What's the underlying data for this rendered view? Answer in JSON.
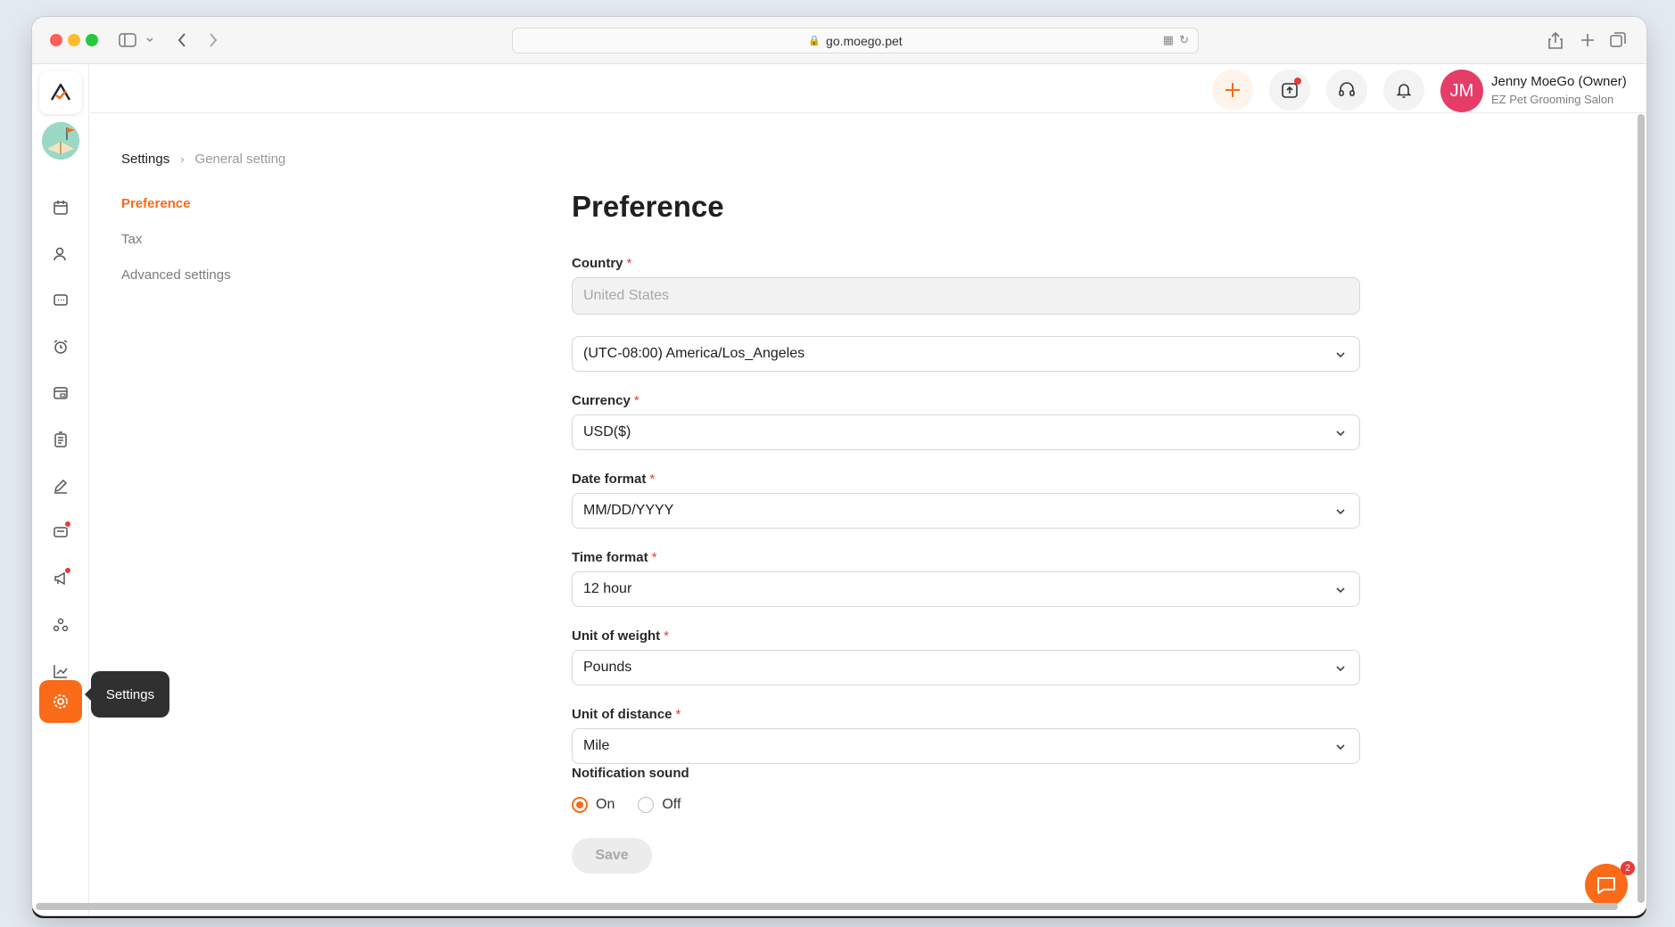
{
  "browser": {
    "url": "go.moego.pet"
  },
  "topbar": {
    "user_initials": "JM",
    "user_name": "Jenny MoeGo (Owner)",
    "user_org": "EZ Pet Grooming Salon"
  },
  "sidebar": {
    "tooltip": "Settings",
    "items": [
      "calendar-icon",
      "clients-icon",
      "messages-icon",
      "alarm-icon",
      "payments-icon",
      "reports-clipboard-icon",
      "edit-icon",
      "retail-icon",
      "marketing-icon",
      "services-icon",
      "insights-icon"
    ]
  },
  "breadcrumb": {
    "current": "Settings",
    "sub": "General setting"
  },
  "leftnav": {
    "items": [
      "Preference",
      "Tax",
      "Advanced settings"
    ]
  },
  "form": {
    "title": "Preference",
    "country_label": "Country",
    "country_placeholder": "United States",
    "timezone_value": "(UTC-08:00) America/Los_Angeles",
    "currency_label": "Currency",
    "currency_value": "USD($)",
    "date_label": "Date format",
    "date_value": "MM/DD/YYYY",
    "time_label": "Time format",
    "time_value": "12 hour",
    "weight_label": "Unit of weight",
    "weight_value": "Pounds",
    "distance_label": "Unit of distance",
    "distance_value": "Mile",
    "sound_label": "Notification sound",
    "sound_on": "On",
    "sound_off": "Off",
    "save_label": "Save"
  },
  "chat": {
    "badge": "2"
  },
  "colors": {
    "accent": "#f96b18",
    "avatar": "#e63d68",
    "required": "#e53b3b"
  }
}
